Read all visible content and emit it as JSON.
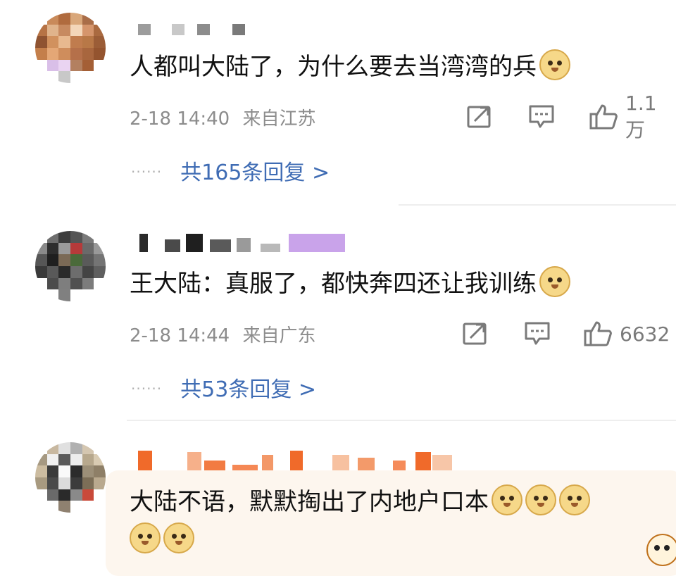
{
  "colors": {
    "reply_link": "#3f6cb4",
    "meta_text": "#8c8c8c",
    "divider": "#eeeeee",
    "highlight_bg": "#fdf6ee"
  },
  "comments": [
    {
      "text": "人都叫大陆了，为什么要去当湾湾的兵",
      "emoji_count": 1,
      "emoji_icon": "doge-emoji-icon",
      "time": "2-18 14:40",
      "location": "来自江苏",
      "likes": "1.1万",
      "replies_prefix": "······",
      "replies": "共165条回复 >"
    },
    {
      "text": "王大陆：真服了，都快奔四还让我训练",
      "emoji_count": 1,
      "emoji_icon": "doge-emoji-icon",
      "time": "2-18 14:44",
      "location": "来自广东",
      "likes": "6632",
      "replies_prefix": "······",
      "replies": "共53条回复 >"
    },
    {
      "text": "大陆不语，默默掏出了内地户口本",
      "emoji_count": 5,
      "emoji_icon": "doge-emoji-icon"
    }
  ],
  "action_icons": [
    "share-icon",
    "comment-icon",
    "like-icon"
  ]
}
